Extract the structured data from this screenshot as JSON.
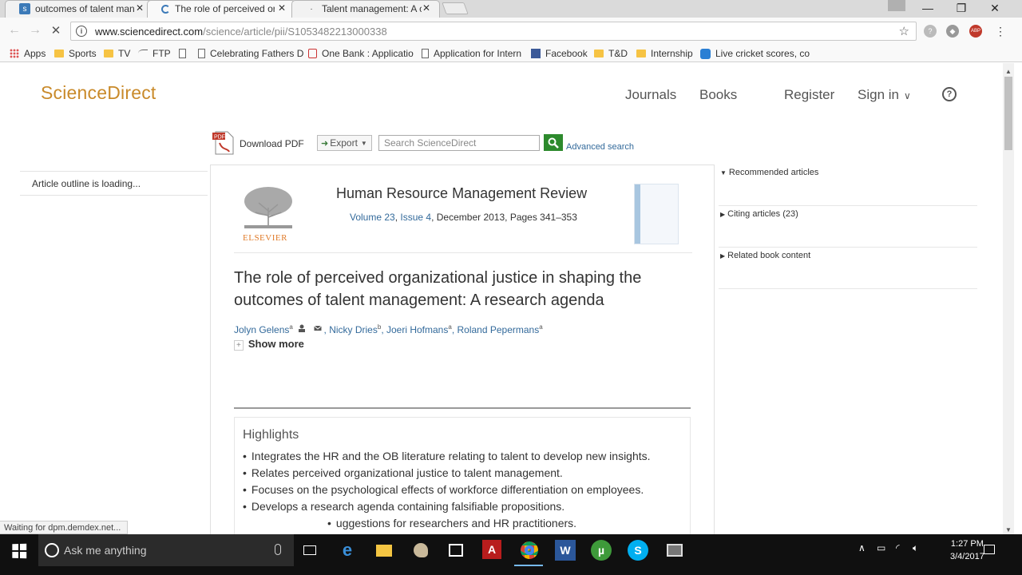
{
  "browser": {
    "tabs": [
      {
        "label": "outcomes of talent mans",
        "active": false
      },
      {
        "label": "The role of perceived org",
        "active": true
      },
      {
        "label": "Talent management: A cr",
        "active": false
      }
    ],
    "url_host": "www.sciencedirect.com",
    "url_path": "/science/article/pii/S1053482213000338",
    "bookmarks": [
      "Apps",
      "Sports",
      "TV",
      "FTP",
      "Celebrating Fathers D",
      "One Bank : Applicatio",
      "Application for Intern",
      "Facebook",
      "T&D",
      "Internship",
      "Live cricket scores, co"
    ],
    "status_text": "Waiting for dpm.demdex.net...",
    "ext_badge": "ABP"
  },
  "site": {
    "logo": "ScienceDirect",
    "nav": {
      "journals": "Journals",
      "books": "Books",
      "register": "Register",
      "signin": "Sign in"
    },
    "toolbar": {
      "download_pdf": "Download PDF",
      "export": "Export",
      "search_placeholder": "Search ScienceDirect",
      "advanced_search": "Advanced search"
    },
    "outline_loading": "Article outline is loading..."
  },
  "article": {
    "journal": "Human Resource Management Review",
    "volume": "Volume 23",
    "issue": "Issue 4",
    "date_pages": ", December 2013, Pages 341–353",
    "title": "The role of perceived organizational justice in shaping the outcomes of talent management: A research agenda",
    "authors": [
      {
        "name": "Jolyn Gelens",
        "sup": "a"
      },
      {
        "name": "Nicky Dries",
        "sup": "b"
      },
      {
        "name": "Joeri Hofmans",
        "sup": "a"
      },
      {
        "name": "Roland Pepermans",
        "sup": "a"
      }
    ],
    "show_more": "Show more",
    "highlights_title": "Highlights",
    "highlights": [
      "Integrates the HR and the OB literature relating to talent to develop new insights.",
      "Relates perceived organizational justice to talent management.",
      "Focuses on the psychological effects of workforce differentiation on employees.",
      "Develops a research agenda containing falsifiable propositions.",
      "uggestions for researchers and HR practitioners."
    ],
    "publisher_logo": "ELSEVIER"
  },
  "sidebar_right": {
    "recommended": "Recommended articles",
    "citing": "Citing articles (23)",
    "related": "Related book content"
  },
  "taskbar": {
    "search_placeholder": "Ask me anything",
    "time": "1:27 PM",
    "date": "3/4/2017"
  },
  "colors": {
    "brand": "#c98a2a",
    "link": "#336a9b",
    "search_button": "#2d8a2d"
  }
}
